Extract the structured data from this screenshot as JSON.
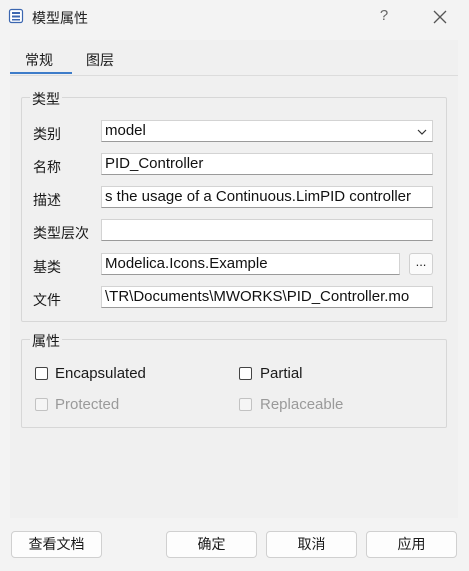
{
  "window": {
    "title": "模型属性",
    "help_label": "?",
    "icon": "properties-icon",
    "close_icon": "close-icon"
  },
  "tabs": [
    {
      "label": "常规",
      "active": true
    },
    {
      "label": "图层",
      "active": false
    }
  ],
  "type_group": {
    "title": "类型",
    "fields": {
      "category": {
        "label": "类别",
        "value": "model"
      },
      "name": {
        "label": "名称",
        "value": "PID_Controller"
      },
      "description": {
        "label": "描述",
        "value": "s the usage of a Continuous.LimPID controller"
      },
      "type_hierarchy": {
        "label": "类型层次",
        "value": ""
      },
      "base_class": {
        "label": "基类",
        "value": "Modelica.Icons.Example",
        "browse_label": "..."
      },
      "file": {
        "label": "文件",
        "value": "\\TR\\Documents\\MWORKS\\PID_Controller.mo"
      }
    }
  },
  "attr_group": {
    "title": "属性",
    "checkboxes": {
      "encapsulated": {
        "label": "Encapsulated",
        "checked": false,
        "enabled": true
      },
      "partial": {
        "label": "Partial",
        "checked": false,
        "enabled": true
      },
      "protected": {
        "label": "Protected",
        "checked": false,
        "enabled": false
      },
      "replaceable": {
        "label": "Replaceable",
        "checked": false,
        "enabled": false
      }
    }
  },
  "buttons": {
    "view_docs": "查看文档",
    "ok": "确定",
    "cancel": "取消",
    "apply": "应用"
  },
  "colors": {
    "accent": "#3d7cc9",
    "background": "#f3f3f3"
  }
}
